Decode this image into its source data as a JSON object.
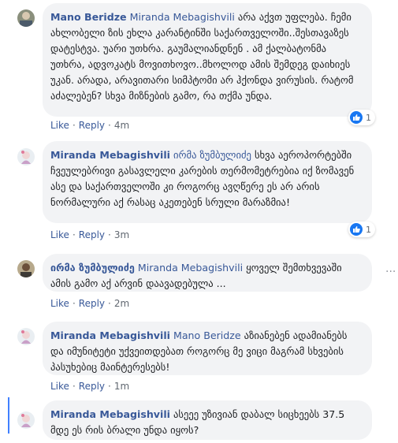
{
  "comments": [
    {
      "author": "Mano Beridze",
      "tag": "Miranda Mebagishvili",
      "text": "არა აქვთ უფლება. ჩემი ახლობელი ზის ეხლა კარანტინში საქართველოში..შესთავაზეს დატესტვა. უარი უთხრა. გაუმალიანდნენ . ამ ქალბატონმა უთხრა, ადვოკატს მოვითხოვო..მხოლოდ ამის შემდეგ დაიხიეს უკან. არადა, არავითარი სიმპტომი არ ჰქონდა ვირუსის. რატომ აძალებენ? სხვა მიზნების გამო, რა თქმა უნდა.",
      "like_label": "Like",
      "reply_label": "Reply",
      "time": "4m",
      "reaction_count": "1"
    },
    {
      "author": "Miranda Mebagishvili",
      "tag": "ირმა ზუმბულიძე",
      "text": "სხვა აეროპორტებში ჩვეულებრივი გასავლელი კარების თერმომეტრებია იქ ზომავენ ასე და საქართველოში კი როგორც ავღწერე ეს არ არის ნორმალური აქ რასაც აკეთებენ სრული მარაზმია!",
      "like_label": "Like",
      "reply_label": "Reply",
      "time": "3m",
      "reaction_count": "1"
    },
    {
      "author": "ირმა ზუმბულიძე",
      "tag": "Miranda Mebagishvili",
      "text": "ყოველ შემთხვევაში ამის გამო აქ არვინ დაავადებულა ...",
      "like_label": "Like",
      "reply_label": "Reply",
      "time": "2m"
    },
    {
      "author": "Miranda Mebagishvili",
      "tag": "Mano Beridze",
      "text": "აზიანებენ ადამიანებს და იმუნიტეტი უქვეითდებათ როგორც მე ვიცი მაგრამ სხვების პასუხებიც მაინტერესებს!",
      "like_label": "Like",
      "reply_label": "Reply",
      "time": "1m"
    },
    {
      "author": "Miranda Mebagishvili",
      "tag": "",
      "text": "ასეეე უზივიან დაბალ სიცხეებს 37.5 მდე ეს რის ბრალი უნდა იყოს?"
    }
  ],
  "more_icon": "···",
  "colors": {
    "link": "#385898",
    "bubble": "#f2f3f5",
    "like_badge": "#1877f2",
    "thread": "#4080ff"
  }
}
